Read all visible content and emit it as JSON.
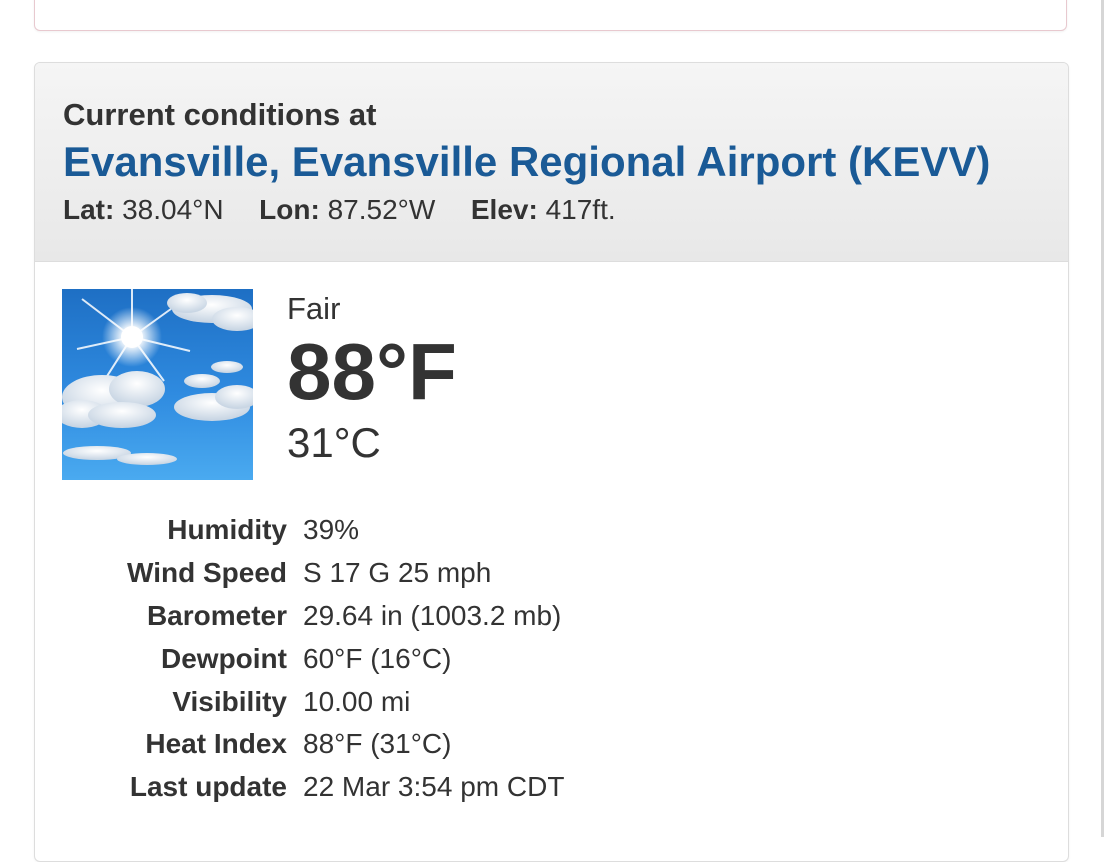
{
  "header": {
    "title": "Current conditions at",
    "station_name": "Evansville, Evansville Regional Airport (KEVV)",
    "lat_label": "Lat:",
    "lat_value": "38.04°N",
    "lon_label": "Lon:",
    "lon_value": "87.52°W",
    "elev_label": "Elev:",
    "elev_value": "417ft."
  },
  "current": {
    "icon": "fair-sky-sun-clouds-icon",
    "description": "Fair",
    "temp_f": "88°F",
    "temp_c": "31°C"
  },
  "details": [
    {
      "label": "Humidity",
      "value": "39%"
    },
    {
      "label": "Wind Speed",
      "value": "S 17 G 25 mph"
    },
    {
      "label": "Barometer",
      "value": "29.64 in (1003.2 mb)"
    },
    {
      "label": "Dewpoint",
      "value": "60°F (16°C)"
    },
    {
      "label": "Visibility",
      "value": "10.00 mi"
    },
    {
      "label": "Heat Index",
      "value": "88°F (31°C)"
    },
    {
      "label": "Last update",
      "value": "22 Mar 3:54 pm CDT"
    }
  ],
  "colors": {
    "station_link": "#1a5a96",
    "heading_bg": "#eeeeee",
    "text": "#333333",
    "sky": "#2f86d6"
  }
}
